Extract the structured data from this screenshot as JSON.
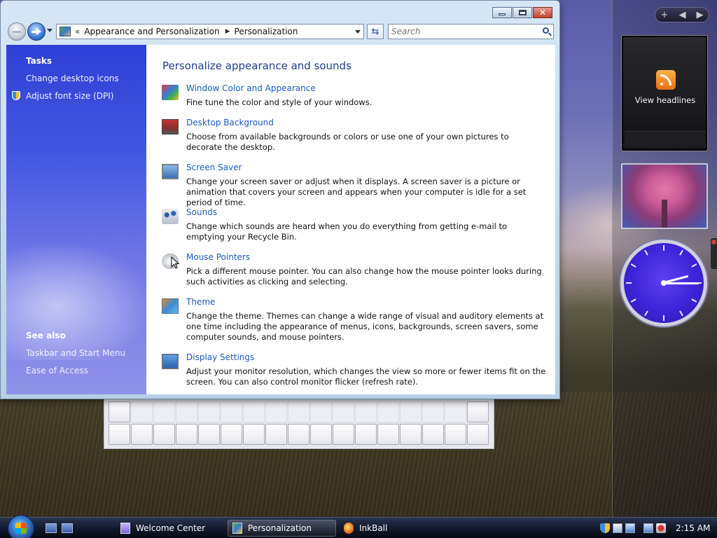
{
  "window": {
    "title": "Personalization",
    "address": {
      "chevron": "«",
      "crumbs": [
        "Appearance and Personalization",
        "Personalization"
      ],
      "separator": "▶"
    },
    "search": {
      "placeholder": "Search"
    }
  },
  "task_pane": {
    "tasks_heading": "Tasks",
    "tasks": [
      "Change desktop icons",
      "Adjust font size (DPI)"
    ],
    "see_also_heading": "See also",
    "see_also": [
      "Taskbar and Start Menu",
      "Ease of Access"
    ]
  },
  "content": {
    "title": "Personalize appearance and sounds",
    "items": [
      {
        "title": "Window Color and Appearance",
        "desc": "Fine tune the color and style of your windows.",
        "icon": "window-color-icon"
      },
      {
        "title": "Desktop Background",
        "desc": "Choose from available backgrounds or colors or use one of your own pictures to decorate the desktop.",
        "icon": "desktop-background-icon"
      },
      {
        "title": "Screen Saver",
        "desc": "Change your screen saver or adjust when it displays. A screen saver is a picture or animation that covers your screen and appears when your computer is idle for a set period of time.",
        "icon": "screen-saver-icon"
      },
      {
        "title": "Sounds",
        "desc": "Change which sounds are heard when you do everything from getting e-mail to emptying your Recycle Bin.",
        "icon": "sounds-icon"
      },
      {
        "title": "Mouse Pointers",
        "desc": "Pick a different mouse pointer. You can also change how the mouse pointer looks during such activities as clicking and selecting.",
        "icon": "mouse-pointers-icon"
      },
      {
        "title": "Theme",
        "desc": "Change the theme. Themes can change a wide range of visual and auditory elements at one time including the appearance of menus, icons, backgrounds, screen savers, some computer sounds, and mouse pointers.",
        "icon": "theme-icon"
      },
      {
        "title": "Display Settings",
        "desc": "Adjust your monitor resolution, which changes the view so more or fewer items fit on the screen. You can also control monitor flicker (refresh rate).",
        "icon": "display-settings-icon"
      }
    ]
  },
  "gadgets": {
    "sidebar_controls": {
      "add": "+",
      "prev": "◀",
      "next": "▶"
    },
    "feed_headlines": {
      "label": "View headlines"
    },
    "clock": {
      "time_shown": "2:15"
    }
  },
  "taskbar": {
    "buttons": [
      {
        "label": "Welcome Center",
        "active": false
      },
      {
        "label": "Personalization",
        "active": true
      },
      {
        "label": "InkBall",
        "active": false
      }
    ],
    "clock": "2:15 AM"
  },
  "colors": {
    "link": "#1c5ab8",
    "page_title": "#1e3d8a",
    "task_pane": "#3b4dd9",
    "clock_face": "#4326d8"
  }
}
